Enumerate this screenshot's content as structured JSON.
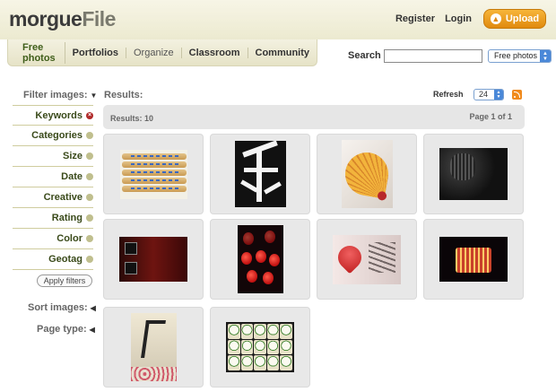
{
  "header": {
    "logo_main": "morgue",
    "logo_accent": "File",
    "register": "Register",
    "login": "Login",
    "upload": "Upload"
  },
  "nav": {
    "tabs": [
      "Free photos",
      "Portfolios",
      "Organize",
      "Classroom",
      "Community"
    ]
  },
  "search": {
    "label": "Search",
    "value": "",
    "scope": "Free photos"
  },
  "sidebar": {
    "filter_heading": "Filter images:",
    "filters": [
      "Keywords",
      "Categories",
      "Size",
      "Date",
      "Creative",
      "Rating",
      "Color",
      "Geotag"
    ],
    "active_filter": "Keywords",
    "apply": "Apply filters",
    "sort_heading": "Sort images:",
    "page_type": "Page type:"
  },
  "results": {
    "heading": "Results:",
    "refresh": "Refresh",
    "per_page": "24",
    "count": "Results: 10",
    "page": "Page 1 of 1",
    "thumbnails": [
      "chopsticks",
      "calligraphy-sign",
      "paper-fan",
      "lantern-dark",
      "red-shrine-signs",
      "red-lanterns",
      "heart-calligraphy",
      "festival-float",
      "calligraphy-scroll",
      "sake-barrels"
    ]
  },
  "colors": {
    "upload": "#e08a0e",
    "nav_bg": "#ecead0",
    "thumb_bg": "#e8e8e8",
    "active_filter_dot": "#b02a2a",
    "filter_dot": "#c0bf8e"
  }
}
